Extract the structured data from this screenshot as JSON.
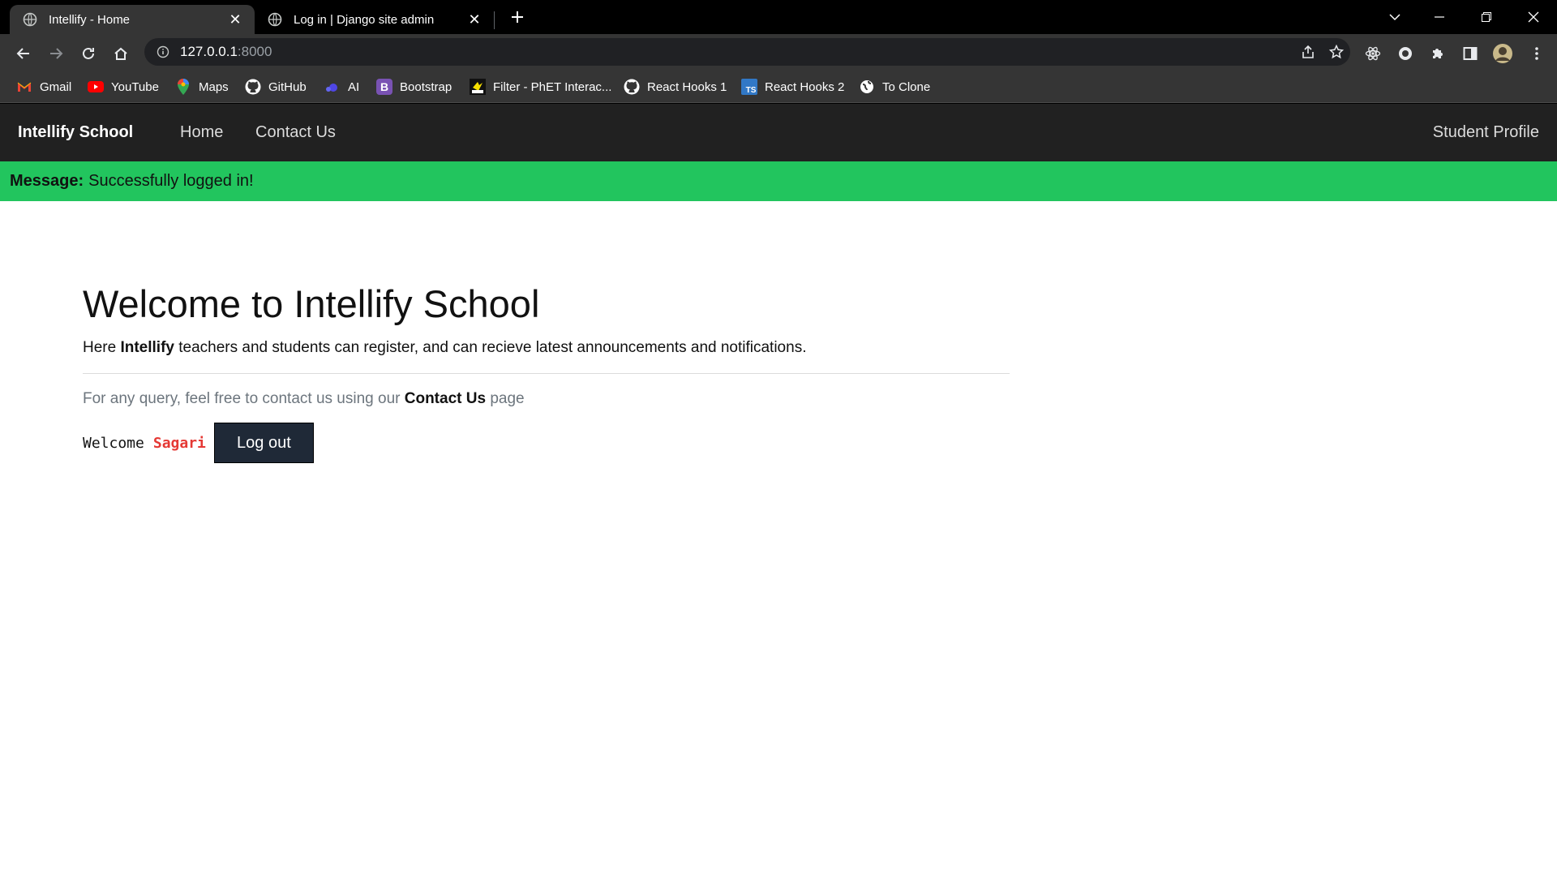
{
  "browser": {
    "tabs": [
      {
        "title": "Intellify - Home",
        "active": true
      },
      {
        "title": "Log in | Django site admin",
        "active": false
      }
    ],
    "url_host": "127.0.0.1",
    "url_port": ":8000",
    "bookmarks": [
      {
        "label": "Gmail",
        "icon": "gmail-icon"
      },
      {
        "label": "YouTube",
        "icon": "youtube-icon"
      },
      {
        "label": "Maps",
        "icon": "maps-icon"
      },
      {
        "label": "GitHub",
        "icon": "github-icon"
      },
      {
        "label": "AI",
        "icon": "ai-icon"
      },
      {
        "label": "Bootstrap",
        "icon": "bootstrap-icon"
      },
      {
        "label": "Filter - PhET Interac...",
        "icon": "phet-icon"
      },
      {
        "label": "React Hooks 1",
        "icon": "github-icon"
      },
      {
        "label": "React Hooks 2",
        "icon": "typescript-icon"
      },
      {
        "label": "To Clone",
        "icon": "globe-icon"
      }
    ]
  },
  "navbar": {
    "brand": "Intellify School",
    "links": [
      "Home",
      "Contact Us"
    ],
    "right_link": "Student Profile"
  },
  "alert": {
    "label": "Message:",
    "text": "Successfully logged in!",
    "color": "#22c55e"
  },
  "main": {
    "heading": "Welcome to Intellify School",
    "lead_prefix": "Here",
    "lead_bold": "Intellify",
    "lead_suffix": "teachers and students can register, and can recieve latest announcements and notifications.",
    "query_prefix": "For any query, feel free to contact us using our",
    "query_link": "Contact Us",
    "query_suffix": "page",
    "welcome_text": "Welcome",
    "username": "Sagari",
    "logout_label": "Log out"
  }
}
